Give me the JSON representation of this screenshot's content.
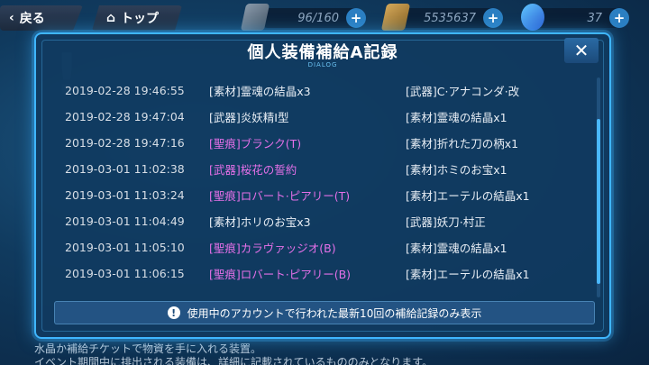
{
  "topbar": {
    "back_label": "戻る",
    "top_label": "トップ",
    "stamina": "96/160",
    "gold": "5535637",
    "crystals": "37"
  },
  "background": {
    "note1": "水晶か補給チケットで物資を手に入れる装置。",
    "note2": "イベント期間中に排出される装備は、詳細に記載されているもののみとなります。"
  },
  "dialog": {
    "title": "個人装備補給A記録",
    "subtitle": "DIALOG",
    "close_label": "✕",
    "rows": [
      {
        "time": "2019-02-28 19:46:55",
        "item1": "[素材]霊魂の結晶x3",
        "item2": "[武器]C·アナコンダ·改",
        "item1_stigma": false,
        "item2_stigma": false
      },
      {
        "time": "2019-02-28 19:47:04",
        "item1": "[武器]炎妖精Ⅰ型",
        "item2": "[素材]霊魂の結晶x1",
        "item1_stigma": false,
        "item2_stigma": false
      },
      {
        "time": "2019-02-28 19:47:16",
        "item1": "[聖痕]ブランク(T)",
        "item2": "[素材]折れた刀の柄x1",
        "item1_stigma": true,
        "item2_stigma": false
      },
      {
        "time": "2019-03-01 11:02:38",
        "item1": "[武器]桜花の誓約",
        "item2": "[素材]ホミのお宝x1",
        "item1_stigma": true,
        "item2_stigma": false
      },
      {
        "time": "2019-03-01 11:03:24",
        "item1": "[聖痕]ロバート·ピアリー(T)",
        "item2": "[素材]エーテルの結晶x1",
        "item1_stigma": true,
        "item2_stigma": false
      },
      {
        "time": "2019-03-01 11:04:49",
        "item1": "[素材]ホリのお宝x3",
        "item2": "[武器]妖刀·村正",
        "item1_stigma": false,
        "item2_stigma": false
      },
      {
        "time": "2019-03-01 11:05:10",
        "item1": "[聖痕]カラヴァッジオ(B)",
        "item2": "[素材]霊魂の結晶x1",
        "item1_stigma": true,
        "item2_stigma": false
      },
      {
        "time": "2019-03-01 11:06:15",
        "item1": "[聖痕]ロバート·ピアリー(B)",
        "item2": "[素材]エーテルの結晶x1",
        "item1_stigma": true,
        "item2_stigma": false
      }
    ],
    "info_text": "使用中のアカウントで行われた最新10回の補給記録のみ表示",
    "scroll_position": 0.75,
    "scroll_visible_fraction": 0.75
  },
  "colors": {
    "accent": "#3fb6ff",
    "stigma": "#e470e8"
  }
}
